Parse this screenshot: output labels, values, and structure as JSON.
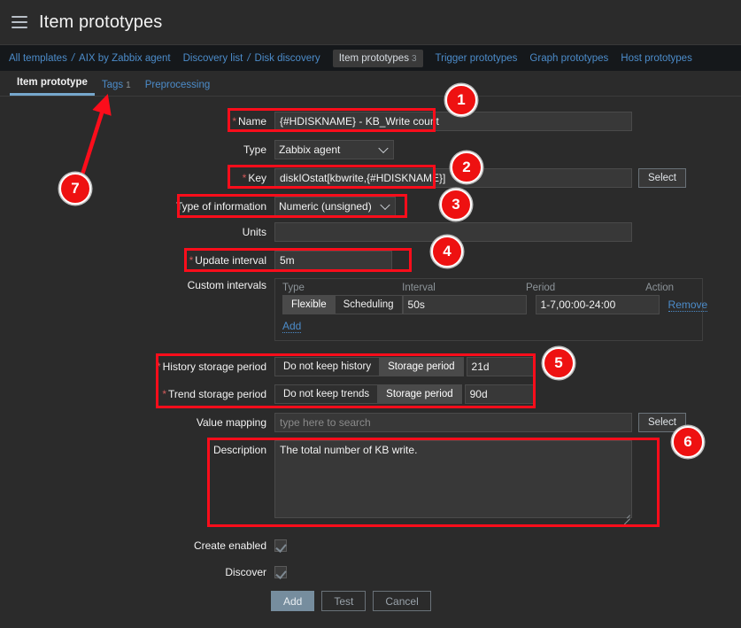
{
  "header": {
    "title": "Item prototypes",
    "menu_icon": "hamburger-icon"
  },
  "breadcrumb": {
    "items": [
      {
        "label": "All templates",
        "type": "link"
      },
      {
        "label": "/",
        "type": "sep"
      },
      {
        "label": "AIX by Zabbix agent",
        "type": "link"
      },
      {
        "label": "gap",
        "type": "gap"
      },
      {
        "label": "Discovery list",
        "type": "link"
      },
      {
        "label": "/",
        "type": "sep"
      },
      {
        "label": "Disk discovery",
        "type": "link"
      },
      {
        "label": "gap",
        "type": "gap"
      },
      {
        "label": "Item prototypes",
        "type": "active",
        "count": "3"
      },
      {
        "label": "gap",
        "type": "gap"
      },
      {
        "label": "Trigger prototypes",
        "type": "link"
      },
      {
        "label": "gap",
        "type": "gap"
      },
      {
        "label": "Graph prototypes",
        "type": "link"
      },
      {
        "label": "gap",
        "type": "gap"
      },
      {
        "label": "Host prototypes",
        "type": "link"
      }
    ]
  },
  "tabs": [
    {
      "label": "Item prototype",
      "selected": true,
      "count": ""
    },
    {
      "label": "Tags",
      "selected": false,
      "count": "1"
    },
    {
      "label": "Preprocessing",
      "selected": false,
      "count": ""
    }
  ],
  "form": {
    "name": {
      "label": "Name",
      "required": true,
      "value": "{#HDISKNAME} - KB_Write count"
    },
    "type": {
      "label": "Type",
      "required": false,
      "value": "Zabbix agent"
    },
    "key": {
      "label": "Key",
      "required": true,
      "value": "diskIOstat[kbwrite,{#HDISKNAME}]",
      "select_button": "Select"
    },
    "type_of_information": {
      "label": "Type of information",
      "required": false,
      "value": "Numeric (unsigned)"
    },
    "units": {
      "label": "Units",
      "required": false,
      "value": ""
    },
    "update_interval": {
      "label": "Update interval",
      "required": true,
      "value": "5m"
    },
    "custom_intervals": {
      "label": "Custom intervals",
      "columns": [
        "Type",
        "Interval",
        "Period",
        "Action"
      ],
      "rows": [
        {
          "type_flexible": "Flexible",
          "type_scheduling": "Scheduling",
          "type_selected": "Flexible",
          "interval": "50s",
          "period": "1-7,00:00-24:00",
          "action": "Remove"
        }
      ],
      "add_link": "Add"
    },
    "history_storage_period": {
      "label": "History storage period",
      "required": true,
      "option_off": "Do not keep history",
      "option_on": "Storage period",
      "selected": "Storage period",
      "value": "21d"
    },
    "trend_storage_period": {
      "label": "Trend storage period",
      "required": true,
      "option_off": "Do not keep trends",
      "option_on": "Storage period",
      "selected": "Storage period",
      "value": "90d"
    },
    "value_mapping": {
      "label": "Value mapping",
      "required": false,
      "value": "",
      "placeholder": "type here to search",
      "select_button": "Select"
    },
    "description": {
      "label": "Description",
      "required": false,
      "value": "The total number of KB write."
    },
    "create_enabled": {
      "label": "Create enabled",
      "checked": true
    },
    "discover": {
      "label": "Discover",
      "checked": true
    },
    "footer": {
      "add": "Add",
      "test": "Test",
      "cancel": "Cancel"
    }
  },
  "annotations": {
    "highlight_color": "#fc0d1b",
    "marker_color": "#ee1111",
    "markers": [
      {
        "id": "1",
        "label": "1"
      },
      {
        "id": "2",
        "label": "2"
      },
      {
        "id": "3",
        "label": "3"
      },
      {
        "id": "4",
        "label": "4"
      },
      {
        "id": "5",
        "label": "5"
      },
      {
        "id": "6",
        "label": "6"
      },
      {
        "id": "7",
        "label": "7"
      }
    ]
  }
}
